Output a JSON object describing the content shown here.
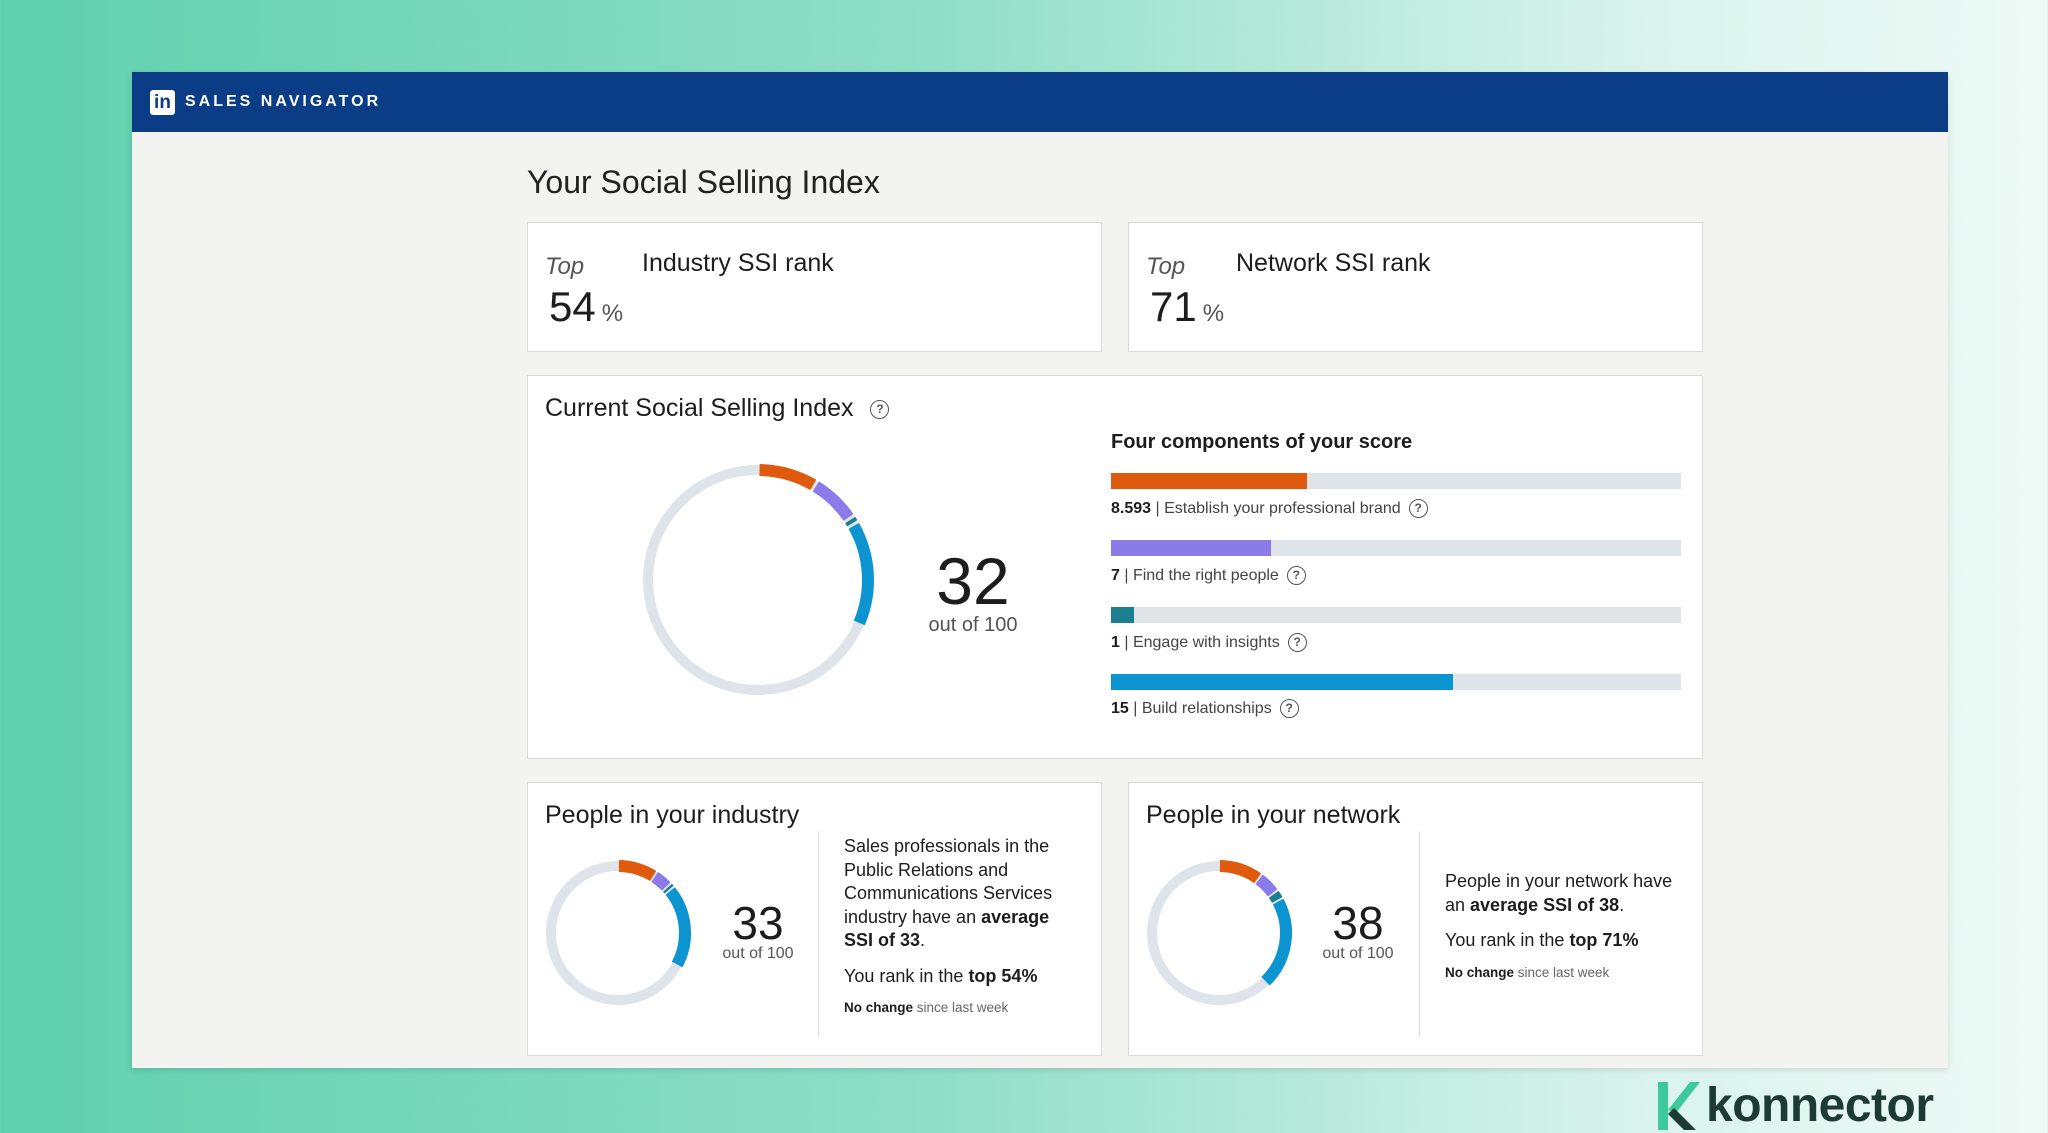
{
  "header": {
    "logo_text": "in",
    "title": "SALES NAVIGATOR"
  },
  "page_title": "Your Social Selling Index",
  "industry_rank": {
    "prefix": "Top",
    "value": "54",
    "unit": "%",
    "title": "Industry SSI rank"
  },
  "network_rank": {
    "prefix": "Top",
    "value": "71",
    "unit": "%",
    "title": "Network SSI rank"
  },
  "current": {
    "title": "Current Social Selling Index",
    "help_glyph": "?",
    "score": "32",
    "out_of": "out of 100",
    "components_title": "Four components of your score",
    "components": [
      {
        "value": "8.593",
        "label": "Establish your professional brand",
        "max": 25,
        "color": "#e05a0d"
      },
      {
        "value": "7",
        "label": "Find the right people",
        "max": 25,
        "color": "#8b7be8"
      },
      {
        "value": "1",
        "label": "Engage with insights",
        "max": 25,
        "color": "#1a7f8e"
      },
      {
        "value": "15",
        "label": "Build relationships",
        "max": 25,
        "color": "#0b94d0"
      }
    ]
  },
  "industry": {
    "title": "People in your industry",
    "score": "33",
    "out_of": "out of 100",
    "desc_text": "Sales professionals in the Public Relations and Communications Services industry have an ",
    "desc_bold": "average SSI of 33",
    "rank_text": "You rank in the ",
    "rank_bold": "top 54%",
    "change_bold": "No change",
    "change_text": " since last week",
    "segments": [
      9,
      4,
      1,
      19
    ]
  },
  "network": {
    "title": "People in your network",
    "score": "38",
    "out_of": "out of 100",
    "desc_text": "People in your network have an ",
    "desc_bold": "average SSI of 38",
    "rank_text": "You rank in the ",
    "rank_bold": "top 71%",
    "change_bold": "No change",
    "change_text": " since last week",
    "segments": [
      10,
      5,
      2,
      21
    ]
  },
  "footer_brand": "konnector",
  "colors": {
    "brand": "#e05a0d",
    "people": "#8b7be8",
    "insights": "#1a7f8e",
    "relationships": "#0b94d0",
    "track": "#dfe4ea",
    "nav": "#0a3d85"
  }
}
